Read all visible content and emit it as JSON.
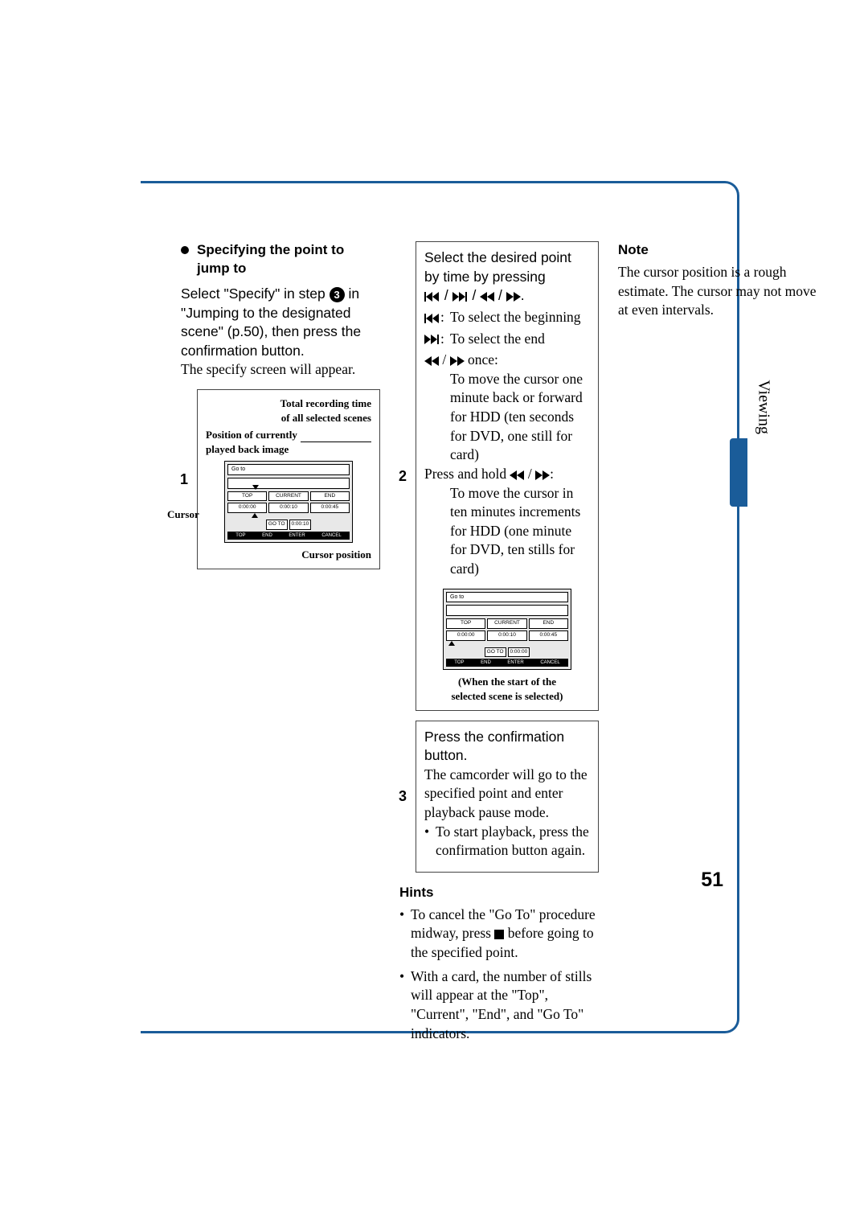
{
  "section_tab": "Viewing",
  "page_number": "51",
  "heading": "Specifying the point to jump to",
  "intro": {
    "a": "Select \"Specify\" in step ",
    "step_ref": "3",
    "b": " in \"Jumping to the designated scene\" (p.50), then press the confirmation button.",
    "sub": "The specify screen will appear."
  },
  "diagram1": {
    "lbl_total1": "Total recording time",
    "lbl_total2": "of all selected scenes",
    "lbl_pos1": "Position of currently",
    "lbl_pos2": "played back image",
    "lbl_cursor": "Cursor",
    "lbl_cursorpos": "Cursor position",
    "screen_title": "Go to",
    "top": "TOP",
    "current": "CURRENT",
    "end": "END",
    "t1": "0:00:00",
    "t2": "0:00:10",
    "t3": "0:00:45",
    "goto": "GO TO",
    "tgoto": "0:00:10",
    "f1": "TOP",
    "f2": "END",
    "f3": "ENTER",
    "f4": "CANCEL"
  },
  "step1_num": "1",
  "step2_num": "2",
  "step2": {
    "line1": "Select the desired point by time by pressing ",
    "skip_begin": "To select the beginning",
    "skip_end": "To select the end",
    "once_suffix": "once:",
    "once_body": "To move the cursor one minute back or forward for HDD (ten seconds for DVD, one still for card)",
    "hold_prefix": "Press and hold",
    "hold_body": "To move the cursor in ten minutes increments for HDD (one minute for DVD, ten stills for card)"
  },
  "diagram2": {
    "screen_title": "Go to",
    "top": "TOP",
    "current": "CURRENT",
    "end": "END",
    "t1": "0:00:00",
    "t2": "0:00:10",
    "t3": "0:00:45",
    "goto": "GO TO",
    "tgoto": "0:00:00",
    "caption1": "(When the start of the",
    "caption2": "selected scene is selected)"
  },
  "step3_num": "3",
  "step3": {
    "line1": "Press the confirmation button.",
    "body": "The camcorder will go to the specified point and enter playback pause mode.",
    "bullet": "To start playback, press the confirmation button again."
  },
  "hints_title": "Hints",
  "hints": {
    "h1a": "To cancel the \"Go To\" procedure midway, press ",
    "h1b": " before going to the specified point.",
    "h2": "With a card, the number of stills will appear at the \"Top\", \"Current\", \"End\", and \"Go To\" indicators."
  },
  "note_title": "Note",
  "note_body": "The cursor position is a rough estimate. The cursor may not move at even intervals."
}
